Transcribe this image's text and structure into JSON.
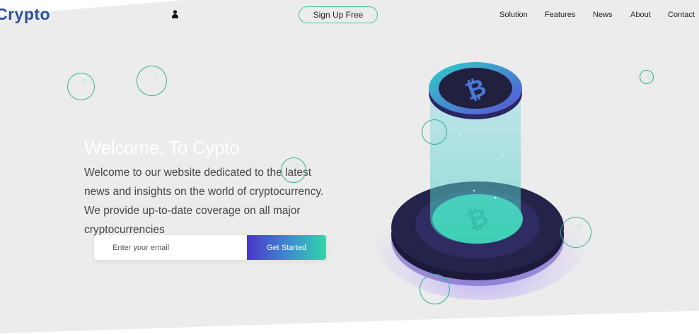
{
  "header": {
    "logo_text": "Crypto",
    "user_icon": "user-icon",
    "signup_label": "Sign Up Free",
    "nav": [
      "Solution",
      "Features",
      "News",
      "About",
      "Contact"
    ]
  },
  "hero": {
    "title": "Welcome, To Cypto",
    "description": "Welcome to our website dedicated to the latest news and insights on the world of cryptocurrency. We provide up-to-date coverage on all major cryptocurrencies",
    "email_placeholder": "Enter your email",
    "email_value": "",
    "cta_label": "Get Started"
  },
  "colors": {
    "accent": "#3fc4a8",
    "brand": "#2a4fa3",
    "button_gradient_start": "#4a35c8",
    "button_gradient_end": "#32d6a8"
  },
  "illustration": {
    "icon": "bitcoin-platform-illustration"
  }
}
